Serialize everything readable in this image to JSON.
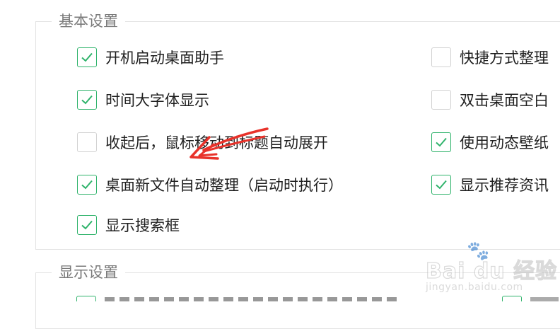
{
  "sections": {
    "basic": {
      "title": "基本设置",
      "left": [
        {
          "label": "开机启动桌面助手",
          "checked": true
        },
        {
          "label": "时间大字体显示",
          "checked": true
        },
        {
          "label": "收起后，鼠标移动到标题自动展开",
          "checked": false
        },
        {
          "label": "桌面新文件自动整理（启动时执行）",
          "checked": true
        },
        {
          "label": "显示搜索框",
          "checked": true
        }
      ],
      "right": [
        {
          "label": "快捷方式整理",
          "checked": false
        },
        {
          "label": "双击桌面空白",
          "checked": false
        },
        {
          "label": "使用动态壁纸",
          "checked": true
        },
        {
          "label": "显示推荐资讯",
          "checked": true
        }
      ]
    },
    "display": {
      "title": "显示设置"
    }
  },
  "colors": {
    "check_green": "#2fb36b",
    "annotation_red": "#e8322a",
    "border_gray": "#d2d2d2"
  },
  "watermark": {
    "logo": "Bai du 经验",
    "url": "jingyan.baidu.com"
  }
}
